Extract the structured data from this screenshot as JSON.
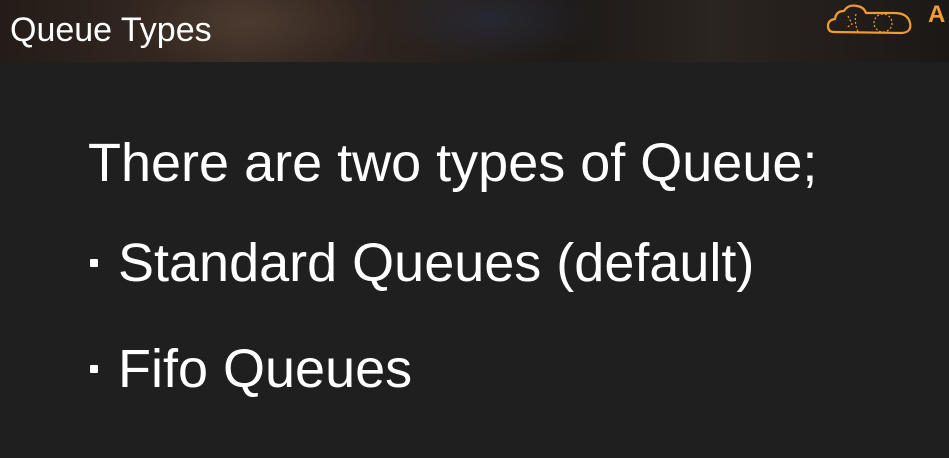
{
  "header": {
    "title": "Queue Types",
    "brand_letter": "A",
    "logo_icon": "cloud-logo-icon",
    "accent_color": "#f29b32"
  },
  "main": {
    "heading": "There are two types of Queue;",
    "bullets": [
      {
        "label": "Standard Queues (default)"
      },
      {
        "label": "Fifo Queues"
      }
    ]
  }
}
